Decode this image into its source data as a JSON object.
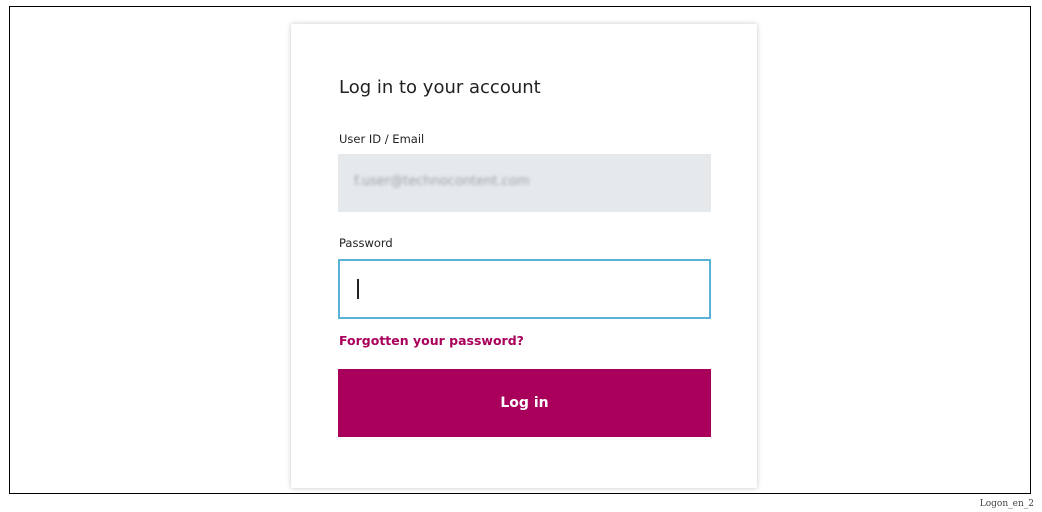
{
  "login_card": {
    "title": "Log in to your account",
    "user_label": "User ID / Email",
    "user_value": "f.user@technocontent.com",
    "password_label": "Password",
    "password_value": "",
    "forgot_link": "Forgotten your password?",
    "login_button": "Log in"
  },
  "caption": "Logon_en_2",
  "colors": {
    "accent": "#a8005b",
    "focus_border": "#5ab3d6",
    "readonly_field_bg": "#e6e9ec"
  }
}
